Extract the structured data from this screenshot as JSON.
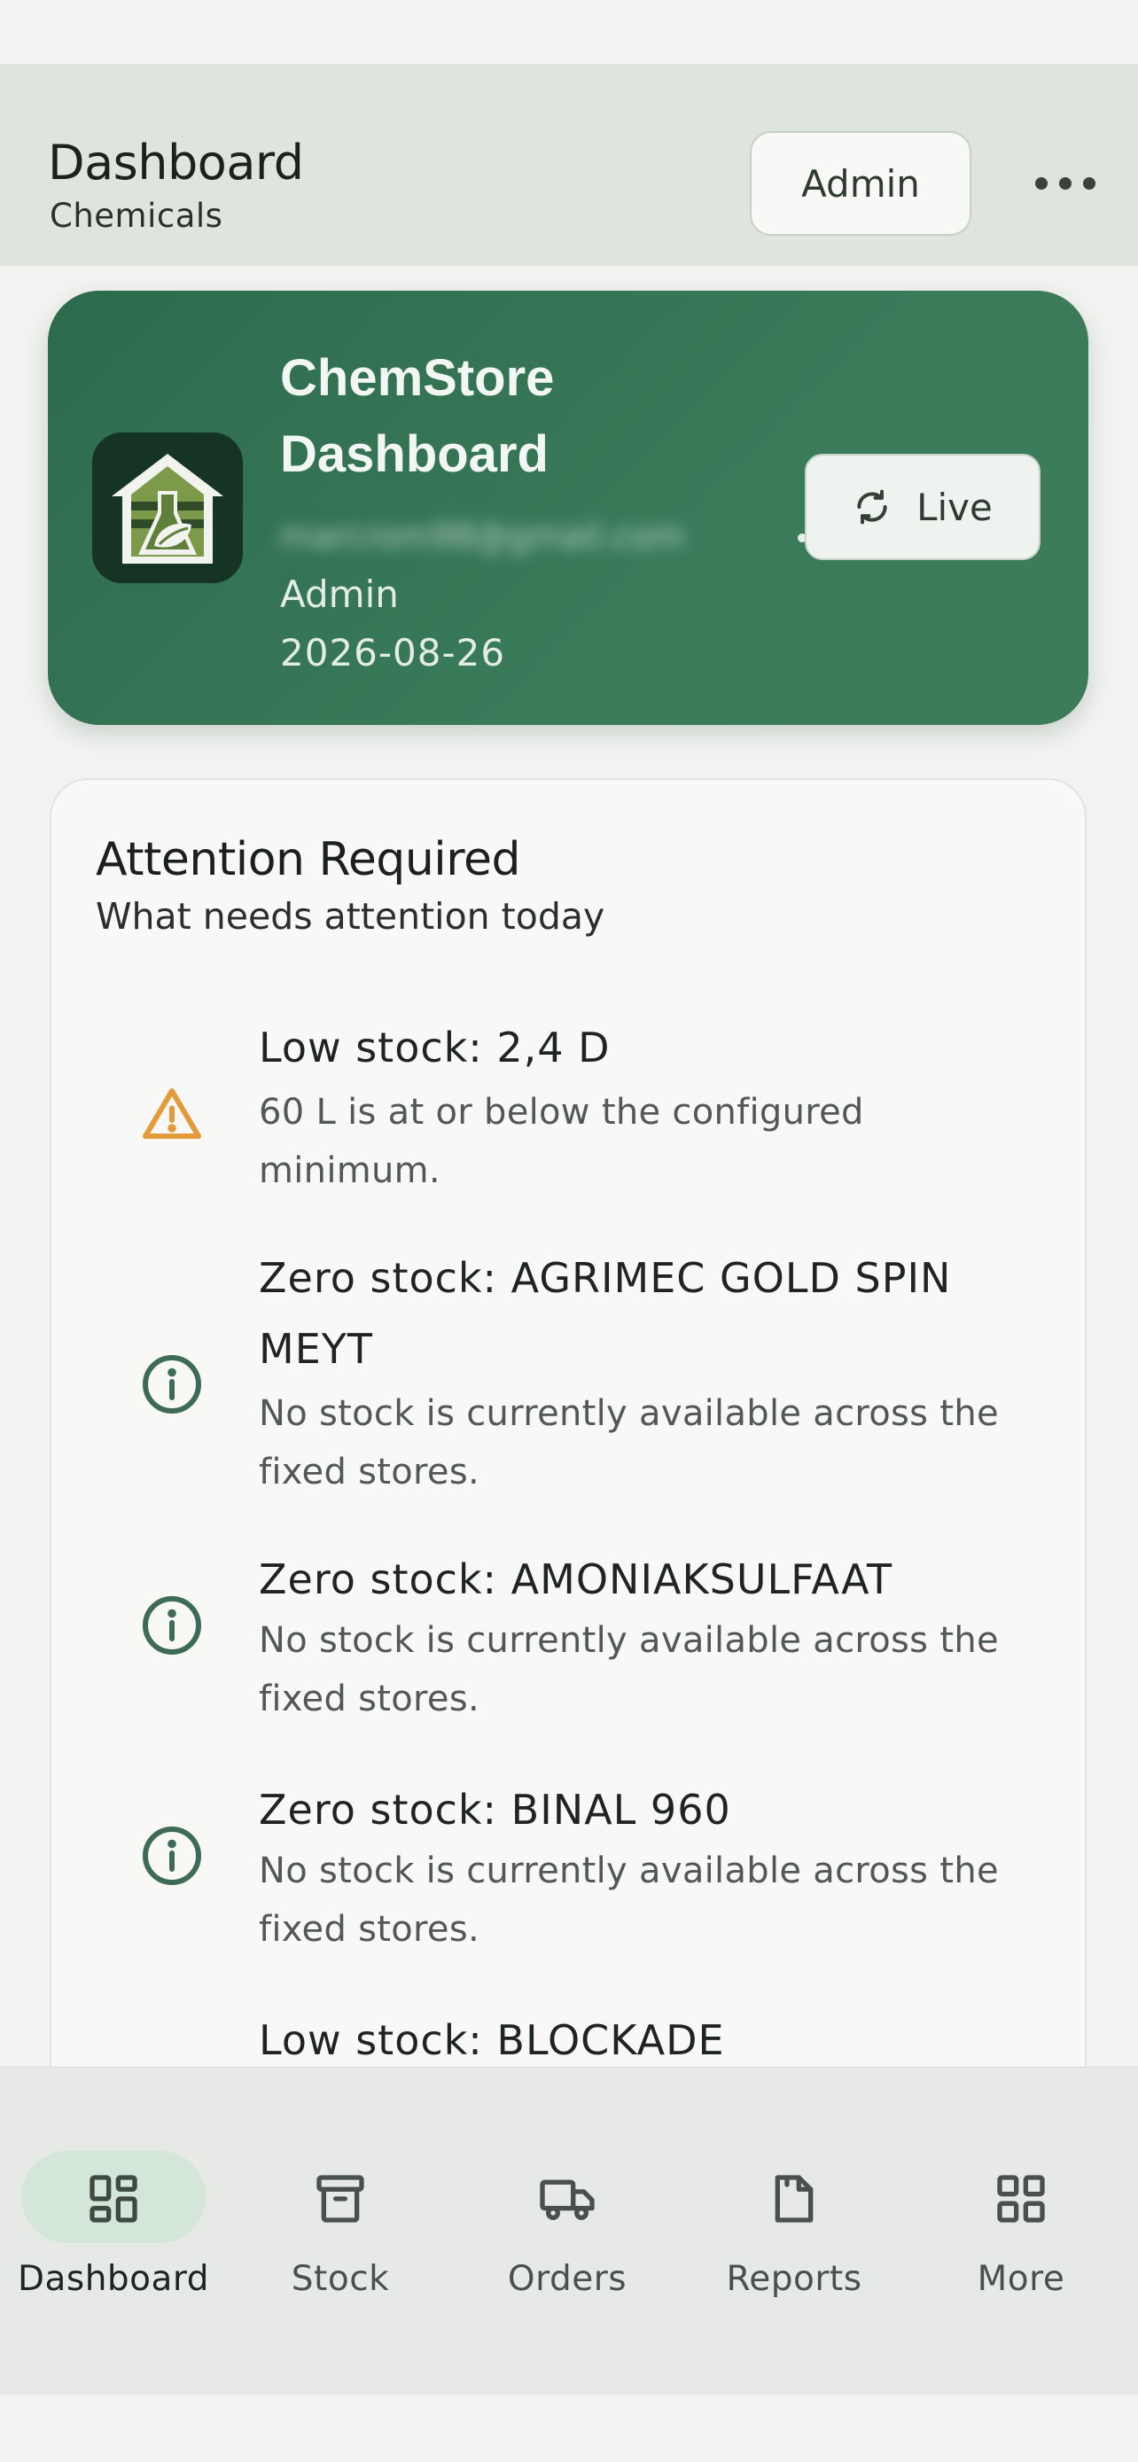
{
  "header": {
    "title": "Dashboard",
    "subtitle": "Chemicals",
    "admin_label": "Admin",
    "more_icon": "more-horizontal-icon"
  },
  "hero": {
    "title_line1": "ChemStore",
    "title_line2": "Dashboard",
    "email": "marcrom98@gmail.com",
    "role": "Admin",
    "date": "2026-08-26",
    "live_label": "Live",
    "live_icon": "refresh-icon",
    "logo_icon": "greenhouse-flask-logo-icon"
  },
  "attention": {
    "title": "Attention Required",
    "subtitle": "What needs attention today",
    "alerts": [
      {
        "kind": "warning",
        "icon": "warning-triangle-icon",
        "title": "Low stock: 2,4 D",
        "description": "60 L is at or below the configured minimum."
      },
      {
        "kind": "info",
        "icon": "info-circle-icon",
        "title": "Zero stock: AGRIMEC GOLD SPIN MEYT",
        "description": "No stock is currently available across the fixed stores."
      },
      {
        "kind": "info",
        "icon": "info-circle-icon",
        "title": "Zero stock: AMONIAKSULFAAT",
        "description": "No stock is currently available across the fixed stores."
      },
      {
        "kind": "info",
        "icon": "info-circle-icon",
        "title": "Zero stock: BINAL 960",
        "description": "No stock is currently available across the fixed stores."
      },
      {
        "kind": "critical",
        "icon": "alert-circle-icon",
        "title": "Low stock: BLOCKADE",
        "description": ""
      }
    ]
  },
  "nav": {
    "items": [
      {
        "label": "Dashboard",
        "icon": "dashboard-icon",
        "active": true
      },
      {
        "label": "Stock",
        "icon": "archive-box-icon",
        "active": false
      },
      {
        "label": "Orders",
        "icon": "truck-icon",
        "active": false
      },
      {
        "label": "Reports",
        "icon": "report-document-icon",
        "active": false
      },
      {
        "label": "More",
        "icon": "grid-icon",
        "active": false
      }
    ]
  },
  "colors": {
    "accent": "#2c6a4c",
    "header_bg": "#dde5dd",
    "warning": "#e49a3a",
    "info": "#3e6b58",
    "critical": "#c9453f",
    "nav_active_pill": "#d4e6d7"
  }
}
